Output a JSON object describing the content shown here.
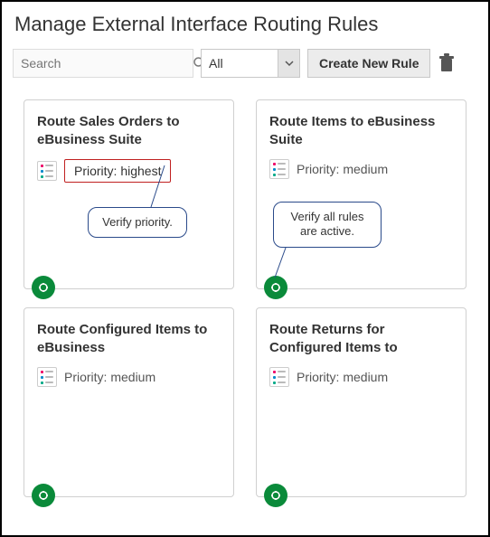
{
  "page": {
    "title": "Manage External Interface Routing Rules"
  },
  "toolbar": {
    "search_placeholder": "Search",
    "filter_selected": "All",
    "create_label": "Create New Rule"
  },
  "cards": [
    {
      "title": "Route Sales Orders to eBusiness Suite",
      "priority_label": "Priority: highest",
      "priority_highlight": true,
      "callout": "Verify priority."
    },
    {
      "title": "Route Items to eBusiness Suite",
      "priority_label": "Priority: medium",
      "priority_highlight": false,
      "callout": "Verify all rules are active."
    },
    {
      "title": "Route Configured Items to eBusiness",
      "priority_label": "Priority: medium",
      "priority_highlight": false
    },
    {
      "title": "Route Returns for Configured Items to",
      "priority_label": "Priority: medium",
      "priority_highlight": false
    }
  ],
  "colors": {
    "badge": "#0a8a3a",
    "highlight_border": "#c02020",
    "callout_border": "#2a4a8a"
  }
}
